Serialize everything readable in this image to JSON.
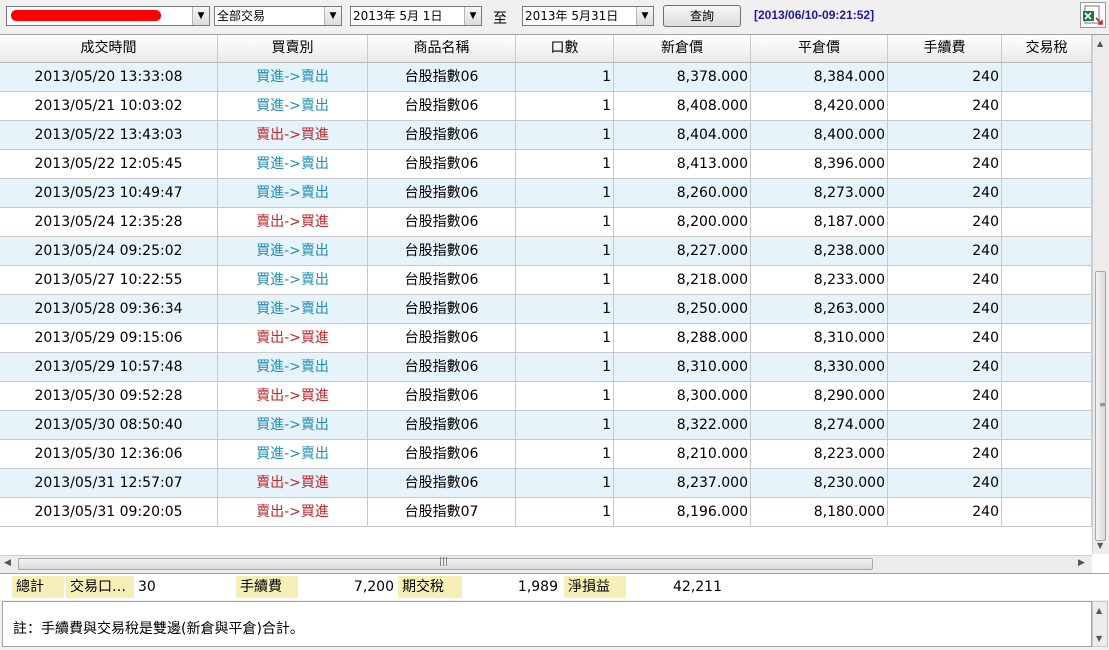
{
  "toolbar": {
    "account_value": "",
    "trade_type": "全部交易",
    "date_from": "2013年  5月  1日",
    "to_label": "至",
    "date_to": "2013年  5月31日",
    "query_label": "查詢",
    "timestamp": "[2013/06/10-09:21:52]"
  },
  "table": {
    "columns": [
      "成交時間",
      "買賣別",
      "商品名稱",
      "口數",
      "新倉價",
      "平倉價",
      "手續費",
      "交易稅"
    ],
    "rows": [
      {
        "time": "2013/05/20 13:33:08",
        "side": "買進->賣出",
        "product": "台股指數06",
        "qty": "1",
        "open": "8,378.000",
        "close": "8,384.000",
        "fee": "240",
        "tax": ""
      },
      {
        "time": "2013/05/21 10:03:02",
        "side": "買進->賣出",
        "product": "台股指數06",
        "qty": "1",
        "open": "8,408.000",
        "close": "8,420.000",
        "fee": "240",
        "tax": ""
      },
      {
        "time": "2013/05/22 13:43:03",
        "side": "賣出->買進",
        "product": "台股指數06",
        "qty": "1",
        "open": "8,404.000",
        "close": "8,400.000",
        "fee": "240",
        "tax": ""
      },
      {
        "time": "2013/05/22 12:05:45",
        "side": "買進->賣出",
        "product": "台股指數06",
        "qty": "1",
        "open": "8,413.000",
        "close": "8,396.000",
        "fee": "240",
        "tax": ""
      },
      {
        "time": "2013/05/23 10:49:47",
        "side": "買進->賣出",
        "product": "台股指數06",
        "qty": "1",
        "open": "8,260.000",
        "close": "8,273.000",
        "fee": "240",
        "tax": ""
      },
      {
        "time": "2013/05/24 12:35:28",
        "side": "賣出->買進",
        "product": "台股指數06",
        "qty": "1",
        "open": "8,200.000",
        "close": "8,187.000",
        "fee": "240",
        "tax": ""
      },
      {
        "time": "2013/05/24 09:25:02",
        "side": "買進->賣出",
        "product": "台股指數06",
        "qty": "1",
        "open": "8,227.000",
        "close": "8,238.000",
        "fee": "240",
        "tax": ""
      },
      {
        "time": "2013/05/27 10:22:55",
        "side": "買進->賣出",
        "product": "台股指數06",
        "qty": "1",
        "open": "8,218.000",
        "close": "8,233.000",
        "fee": "240",
        "tax": ""
      },
      {
        "time": "2013/05/28 09:36:34",
        "side": "買進->賣出",
        "product": "台股指數06",
        "qty": "1",
        "open": "8,250.000",
        "close": "8,263.000",
        "fee": "240",
        "tax": ""
      },
      {
        "time": "2013/05/29 09:15:06",
        "side": "賣出->買進",
        "product": "台股指數06",
        "qty": "1",
        "open": "8,288.000",
        "close": "8,310.000",
        "fee": "240",
        "tax": ""
      },
      {
        "time": "2013/05/29 10:57:48",
        "side": "買進->賣出",
        "product": "台股指數06",
        "qty": "1",
        "open": "8,310.000",
        "close": "8,330.000",
        "fee": "240",
        "tax": ""
      },
      {
        "time": "2013/05/30 09:52:28",
        "side": "賣出->買進",
        "product": "台股指數06",
        "qty": "1",
        "open": "8,300.000",
        "close": "8,290.000",
        "fee": "240",
        "tax": ""
      },
      {
        "time": "2013/05/30 08:50:40",
        "side": "買進->賣出",
        "product": "台股指數06",
        "qty": "1",
        "open": "8,322.000",
        "close": "8,274.000",
        "fee": "240",
        "tax": ""
      },
      {
        "time": "2013/05/30 12:36:06",
        "side": "買進->賣出",
        "product": "台股指數06",
        "qty": "1",
        "open": "8,210.000",
        "close": "8,223.000",
        "fee": "240",
        "tax": ""
      },
      {
        "time": "2013/05/31 12:57:07",
        "side": "賣出->買進",
        "product": "台股指數06",
        "qty": "1",
        "open": "8,237.000",
        "close": "8,230.000",
        "fee": "240",
        "tax": ""
      },
      {
        "time": "2013/05/31 09:20:05",
        "side": "賣出->買進",
        "product": "台股指數07",
        "qty": "1",
        "open": "8,196.000",
        "close": "8,180.000",
        "fee": "240",
        "tax": ""
      }
    ]
  },
  "summary": {
    "total_label": "總計",
    "lots_label": "交易口…",
    "lots_value": "30",
    "fee_label": "手續費",
    "fee_value": "7,200",
    "tax_label": "期交稅",
    "tax_value": "1,989",
    "pnl_label": "淨損益",
    "pnl_value": "42,211"
  },
  "note": {
    "text": "註：手續費與交易稅是雙邊(新倉與平倉)合計。"
  },
  "colors": {
    "buy_sell": "#1f8fb5",
    "sell_buy": "#c0262b",
    "row_alt": "#e6f3fb",
    "timestamp": "#1a1aa6",
    "summary_label_bg": "#f7efb8"
  },
  "icons": {
    "excel_export": "excel-export-icon"
  }
}
